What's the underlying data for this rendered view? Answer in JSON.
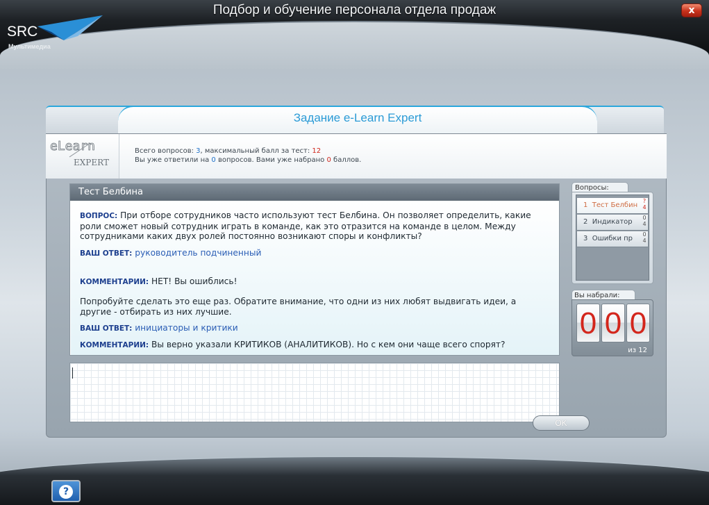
{
  "app": {
    "title": "Подбор и обучение персонала отдела продаж",
    "close_label": "x",
    "logo": {
      "brand": "SRC",
      "subtitle": "Мультимедиа"
    }
  },
  "dialog": {
    "title": "Задание e-Learn Expert",
    "info": {
      "total_prefix": "Всего вопросов: ",
      "total_questions": "3",
      "max_prefix": ", максимальный балл за тест: ",
      "max_score": "12",
      "answered_prefix": "Вы уже ответили на ",
      "answered_count": "0",
      "answered_mid": " вопросов. Вами уже набрано ",
      "points": "0",
      "answered_suffix": " баллов."
    },
    "logo_text": {
      "top": "eLearn",
      "bottom": "EXPERT"
    }
  },
  "question": {
    "header": "Тест Белбина",
    "question_label": "ВОПРОС:",
    "question_text": " При отборе сотрудников часто используют тест Белбина. Он позволяет определить, какие роли сможет новый сотрудник играть в команде, как это отразится на команде в целом. Между сотрудниками каких двух ролей постоянно возникают споры и конфликты?",
    "answer1_label": "ВАШ ОТВЕТ:",
    "answer1_text": " руководитель подчиненный",
    "comment1_label": "КОММЕНТАРИИ:",
    "comment1_text": " НЕТ! Вы ошиблись!",
    "hint_text": "Попробуйте сделать это еще раз. Обратите внимание, что одни из них любят выдвигать идеи, а другие - отбирать из них лучшие.",
    "answer2_label": "ВАШ ОТВЕТ:",
    "answer2_text": " инициаторы и критики",
    "comment2_label": "КОММЕНТАРИИ:",
    "comment2_text": " Вы верно указали КРИТИКОВ (АНАЛИТИКОВ). Но с кем они чаще всего спорят?"
  },
  "answer_input": {
    "value": ""
  },
  "ok_label": "OK",
  "questions_panel": {
    "label": "Вопросы:",
    "items": [
      {
        "num": "1",
        "label": "Тест Белбин",
        "score_top": "?",
        "score_bottom": "4"
      },
      {
        "num": "2",
        "label": "Индикатор",
        "score_top": "0",
        "score_bottom": "4"
      },
      {
        "num": "3",
        "label": "Ошибки пр",
        "score_top": "0",
        "score_bottom": "4"
      }
    ]
  },
  "score_panel": {
    "label": "Вы набрали:",
    "digits": [
      "0",
      "0",
      "0"
    ],
    "of_text": "из 12"
  },
  "help_label": "?",
  "colors": {
    "accent": "#2b9bd6",
    "digit_red": "#d3261c",
    "close_red": "#c7321c",
    "label_blue": "#1d3f8e"
  }
}
